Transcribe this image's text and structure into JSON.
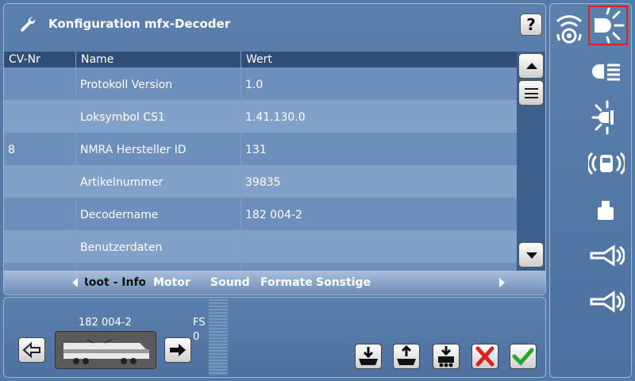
{
  "header": {
    "title": "Konfiguration mfx-Decoder",
    "help_label": "?"
  },
  "table": {
    "columns": [
      "CV-Nr",
      "Name",
      "Wert"
    ],
    "rows": [
      {
        "cv": "",
        "name": "Protokoll Version",
        "value": "1.0"
      },
      {
        "cv": "",
        "name": "Loksymbol CS1",
        "value": "1.41.130.0"
      },
      {
        "cv": "8",
        "name": "NMRA Hersteller ID",
        "value": "131"
      },
      {
        "cv": "",
        "name": "Artikelnummer",
        "value": "39835"
      },
      {
        "cv": "",
        "name": "Decodername",
        "value": "182 004-2"
      },
      {
        "cv": "",
        "name": "Benutzerdaten",
        "value": ""
      }
    ]
  },
  "tabs": {
    "active": "Root - Info",
    "items": [
      "Root - Info",
      "Motor",
      "Sound",
      "Formate",
      "Sonstige"
    ]
  },
  "loco": {
    "name": "182 004-2",
    "fs_label": "FS",
    "fs_value": "0"
  },
  "side_icons": [
    "radio-icon",
    "light-icon",
    "beam-icon",
    "strobe-icon",
    "car-icon",
    "weight-icon",
    "horn-icon",
    "horn-icon"
  ],
  "colors": {
    "background": "#5579a6",
    "header_row": "#2f4e78",
    "cancel": "#e02020",
    "ok": "#2aa52a",
    "highlight": "#e02020"
  }
}
